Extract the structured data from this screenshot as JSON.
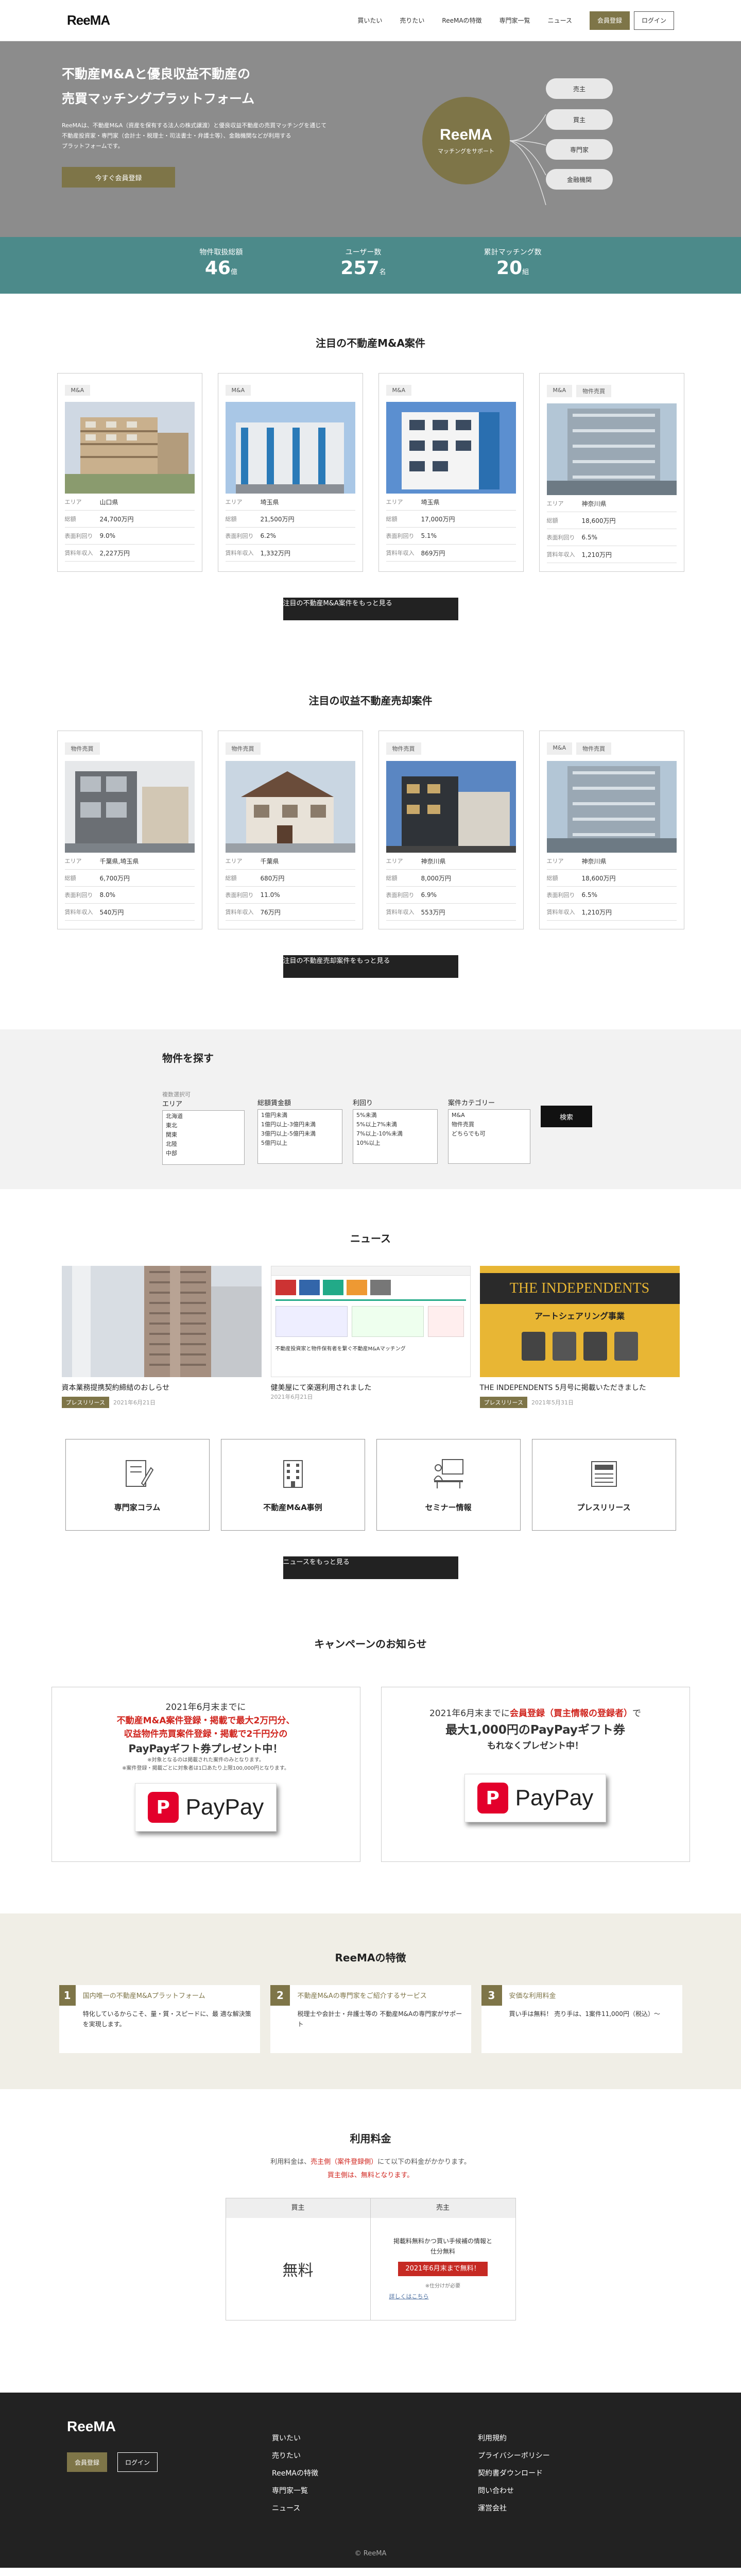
{
  "header": {
    "logo": "ReeMA",
    "nav": [
      "買いたい",
      "売りたい",
      "ReeMAの特徴",
      "専門家一覧",
      "ニュース"
    ],
    "register": "会員登録",
    "login": "ログイン"
  },
  "hero": {
    "title1": "不動産M&Aと優良収益不動産の",
    "title2": "売買マッチングプラットフォーム",
    "desc1": "ReeMAは、不動産M&A（資産を保有する法人の株式譲渡）と優良収益不動産の売買マッチングを通じて",
    "desc2": "不動産投資家・専門家（会計士・税理士・司法書士・弁護士等）、金融機関などが利用する",
    "desc3": "プラットフォームです。",
    "cta": "今すぐ会員登録",
    "circle_logo": "ReeMA",
    "circle_sub": "マッチングをサポート",
    "pills": [
      "売主",
      "買主",
      "専門家",
      "金融機関"
    ]
  },
  "stats": [
    {
      "label": "物件取扱総額",
      "value": "46",
      "unit": "億"
    },
    {
      "label": "ユーザー数",
      "value": "257",
      "unit": "名"
    },
    {
      "label": "累計マッチング数",
      "value": "20",
      "unit": "組"
    }
  ],
  "ma": {
    "title": "注目の不動産M&A案件",
    "row_keys": [
      "エリア",
      "総額",
      "表面利回り",
      "賃料年収入"
    ],
    "cards": [
      {
        "tags": [
          "M&A"
        ],
        "area": "山口県",
        "total": "24,700万円",
        "yield": "9.0%",
        "income": "2,227万円"
      },
      {
        "tags": [
          "M&A"
        ],
        "area": "埼玉県",
        "total": "21,500万円",
        "yield": "6.2%",
        "income": "1,332万円"
      },
      {
        "tags": [
          "M&A"
        ],
        "area": "埼玉県",
        "total": "17,000万円",
        "yield": "5.1%",
        "income": "869万円"
      },
      {
        "tags": [
          "M&A",
          "物件売買"
        ],
        "area": "神奈川県",
        "total": "18,600万円",
        "yield": "6.5%",
        "income": "1,210万円"
      }
    ],
    "more": "注目の不動産M&A案件をもっと見る"
  },
  "sale": {
    "title": "注目の収益不動産売却案件",
    "cards": [
      {
        "tags": [
          "物件売買"
        ],
        "area": "千葉県,埼玉県",
        "total": "6,700万円",
        "yield": "8.0%",
        "income": "540万円"
      },
      {
        "tags": [
          "物件売買"
        ],
        "area": "千葉県",
        "total": "680万円",
        "yield": "11.0%",
        "income": "76万円"
      },
      {
        "tags": [
          "物件売買"
        ],
        "area": "神奈川県",
        "total": "8,000万円",
        "yield": "6.9%",
        "income": "553万円"
      },
      {
        "tags": [
          "M&A",
          "物件売買"
        ],
        "area": "神奈川県",
        "total": "18,600万円",
        "yield": "6.5%",
        "income": "1,210万円"
      }
    ],
    "more": "注目の不動産売却案件をもっと見る"
  },
  "search": {
    "title": "物件を探す",
    "area_cap": "複数選択可",
    "area_label": "エリア",
    "area_opts": [
      "北海道",
      "東北",
      "関東",
      "北陸",
      "中部"
    ],
    "price_label": "総額賃金額",
    "price_opts": [
      "1億円未満",
      "1億円以上-3億円未満",
      "3億円以上-5億円未満",
      "5億円以上"
    ],
    "yield_label": "利回り",
    "yield_opts": [
      "5%未満",
      "5%以上7%未満",
      "7%以上-10%未満",
      "10%以上"
    ],
    "cat_label": "案件カテゴリー",
    "cat_opts": [
      "M&A",
      "物件売買",
      "どちらでも可"
    ],
    "button": "検索"
  },
  "news": {
    "title": "ニュース",
    "items": [
      {
        "caption": "資本業務提携契約締結のおしらせ",
        "badge": "プレスリリース",
        "date": "2021年6月21日"
      },
      {
        "caption": "健美屋にて楽選利用されました",
        "badge": "",
        "date": "2021年6月21日",
        "img_title": "不動産投資家と物件保有者を繋ぐ不動産M&Aマッチング"
      },
      {
        "caption": "THE INDEPENDENTS 5月号に掲載いただきました",
        "badge": "プレスリリース",
        "date": "2021年5月31日",
        "img_title": "THE INDEPENDENTS",
        "img_sub": "アートシェアリング事業"
      }
    ],
    "categories": [
      "専門家コラム",
      "不動産M&A事例",
      "セミナー情報",
      "プレスリリース"
    ],
    "more": "ニュースをもっと見る"
  },
  "campaign": {
    "title": "キャンペーンのお知らせ",
    "c1_l1": "2021年6月末までに",
    "c1_l2": "不動産M&A案件登録・掲載で最大2万円分、",
    "c1_l3": "収益物件売買案件登録・掲載で2千円分の",
    "c1_l4": "PayPayギフト券プレゼント中！",
    "c1_note1": "※対象となるのは掲載された案件のみとなります。",
    "c1_note2": "※案件登録・掲載ごとに対象者は1口あたり上限100,000円となります。",
    "c2_l1a": "2021年6月末までに",
    "c2_l1b": "会員登録（買主情報の登録者）",
    "c2_l1c": "で",
    "c2_l2": "最大1,000円のPayPayギフト券",
    "c2_l3": "もれなくプレゼント中！",
    "paypay": "PayPay"
  },
  "features": {
    "title": "ReeMAの特徴",
    "items": [
      {
        "num": "1",
        "title": "国内唯一の不動産M&Aプラットフォーム",
        "body": "特化しているからこそ、量・質・スピードに、最 適な解決策を実現します。"
      },
      {
        "num": "2",
        "title": "不動産M&Aの専門家をご紹介するサービス",
        "body": "税理士や会計士・弁護士等の 不動産M&Aの専門家がサポート"
      },
      {
        "num": "3",
        "title": "安価な利用料金",
        "body": "買い手は無料！ 売り手は、1案件11,000円（税込）〜"
      }
    ]
  },
  "pricing": {
    "title": "利用料金",
    "desc1": "利用料金は、",
    "desc1_red": "売主側（案件登録側）",
    "desc1_end": "にて以下の料金がかかります。",
    "desc2": "買主側は、無料となります。",
    "buyer_head": "買主",
    "buyer_body": "無料",
    "seller_head": "売主",
    "seller_body1": "掲載料無料かつ買い手候補の情報と",
    "seller_body2": "仕分無料",
    "seller_badge": "2021年6月末まで無料！",
    "seller_note": "※仕分けが必要",
    "seller_link": "詳しくはこちら"
  },
  "footer": {
    "logo": "ReeMA",
    "register": "会員登録",
    "login": "ログイン",
    "col1": [
      "買いたい",
      "売りたい",
      "ReeMAの特徴",
      "専門家一覧",
      "ニュース"
    ],
    "col2": [
      "利用規約",
      "プライバシーポリシー",
      "契約書ダウンロード",
      "問い合わせ",
      "運営会社"
    ],
    "copy": "© ReeMA"
  },
  "colors": {
    "gold": "#7e7548",
    "teal": "#4c8a8a",
    "red": "#d0251e",
    "dark": "#222222"
  }
}
